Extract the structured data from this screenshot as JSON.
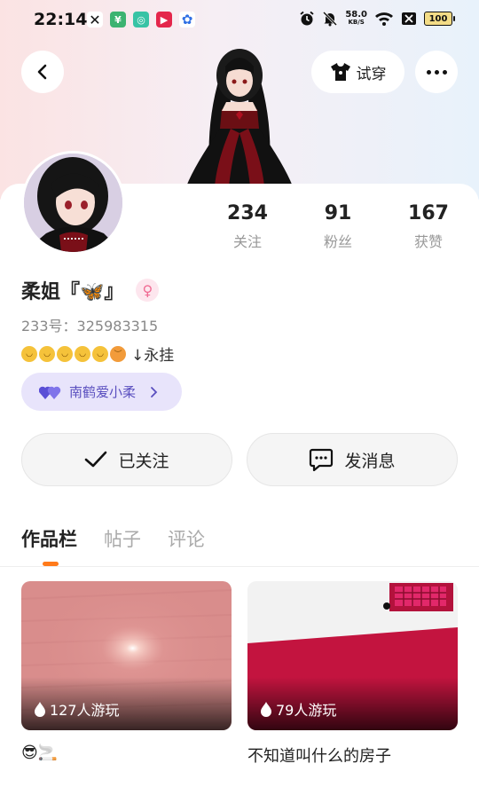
{
  "status_bar": {
    "time": "22:14",
    "net_speed": "58.0",
    "net_unit": "KB/S",
    "battery": "100"
  },
  "header": {
    "tryon_label": "试穿"
  },
  "profile": {
    "name": "柔姐『🦋』",
    "gender_symbol": "♀",
    "uid": "233号：325983315",
    "bio_suffix": "↓永挂",
    "couple_label": "南鹤爱小柔"
  },
  "stats": [
    {
      "value": "234",
      "label": "关注"
    },
    {
      "value": "91",
      "label": "粉丝"
    },
    {
      "value": "167",
      "label": "获赞"
    }
  ],
  "actions": {
    "follow_label": "已关注",
    "message_label": "发消息"
  },
  "tabs": [
    "作品栏",
    "帖子",
    "评论"
  ],
  "works": [
    {
      "plays": "127人游玩",
      "title": "😎🚬"
    },
    {
      "plays": "79人游玩",
      "title": "不知道叫什么的房子"
    }
  ],
  "colors": {
    "accent_orange": "#ff7a1a",
    "couple_bg": "#e8e4fb",
    "couple_text": "#5a4fbf"
  }
}
